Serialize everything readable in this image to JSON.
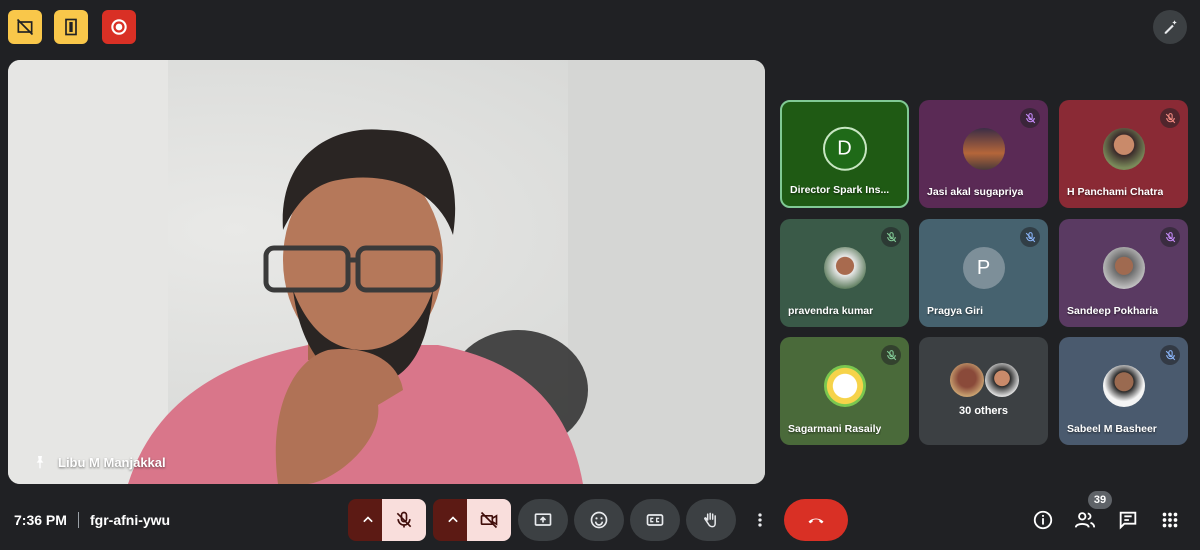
{
  "meeting": {
    "time": "7:36 PM",
    "code": "fgr-afni-ywu"
  },
  "indicators": [
    {
      "icon": "no-recording-icon",
      "color": "#f9c74a"
    },
    {
      "icon": "door-icon",
      "color": "#f9c74a"
    },
    {
      "icon": "record-icon",
      "color": "#d93025"
    }
  ],
  "main_speaker": {
    "name": "Libu M Manjakkal",
    "icon": "pin-icon"
  },
  "tiles": [
    {
      "name": "Director Spark Ins...",
      "avatar": "D",
      "avatar_color": "#2e7d32",
      "bg": "#1f5a14",
      "active": true,
      "muted": false
    },
    {
      "name": "Jasi akal sugapriya",
      "avatar": "photo",
      "bg": "#5a2a55",
      "muted": true
    },
    {
      "name": "H Panchami Chatra",
      "avatar": "photo",
      "bg": "#8a2a35",
      "muted": true
    },
    {
      "name": "pravendra kumar",
      "avatar": "photo",
      "bg": "#3a5a48",
      "muted": true
    },
    {
      "name": "Pragya Giri",
      "avatar": "P",
      "avatar_color": "#7d8f99",
      "bg": "#46626f",
      "muted": true
    },
    {
      "name": "Sandeep Pokharia",
      "avatar": "photo",
      "bg": "#5a3a62",
      "muted": true
    },
    {
      "name": "Sagarmani Rasaily",
      "avatar": "photo",
      "bg": "#4a6a3a",
      "muted": true
    },
    {
      "name": "30 others",
      "avatar": "group",
      "bg": "#3c4043",
      "muted": false
    },
    {
      "name": "Sabeel M Basheer",
      "avatar": "photo",
      "bg": "#4a5a6e",
      "muted": true
    }
  ],
  "controls": {
    "mic": {
      "state": "off"
    },
    "camera": {
      "state": "off"
    },
    "buttons": [
      "present-icon",
      "emoji-icon",
      "captions-icon",
      "raise-hand-icon",
      "more-vert-icon"
    ],
    "end_call": "end-call-icon"
  },
  "right": {
    "people_count": "39",
    "icons": [
      "info-icon",
      "people-icon",
      "chat-icon",
      "apps-icon"
    ]
  },
  "colors": {
    "bg": "#202124",
    "accent_green": "#81c995",
    "danger": "#d93025"
  }
}
